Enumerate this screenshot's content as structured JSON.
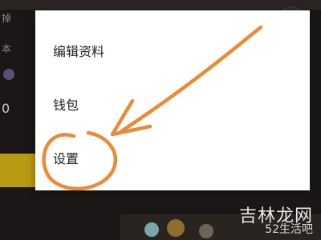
{
  "background": {
    "left_texts": [
      "掉",
      "本",
      "0"
    ]
  },
  "menu": {
    "items": [
      {
        "label": "编辑资料"
      },
      {
        "label": "钱包"
      },
      {
        "label": "设置"
      }
    ]
  },
  "annotation": {
    "color": "#ec8a36",
    "meaning": "arrow pointing to settings item"
  },
  "watermark": {
    "title": "吉林龙网",
    "subtitle": "52生活吧"
  }
}
